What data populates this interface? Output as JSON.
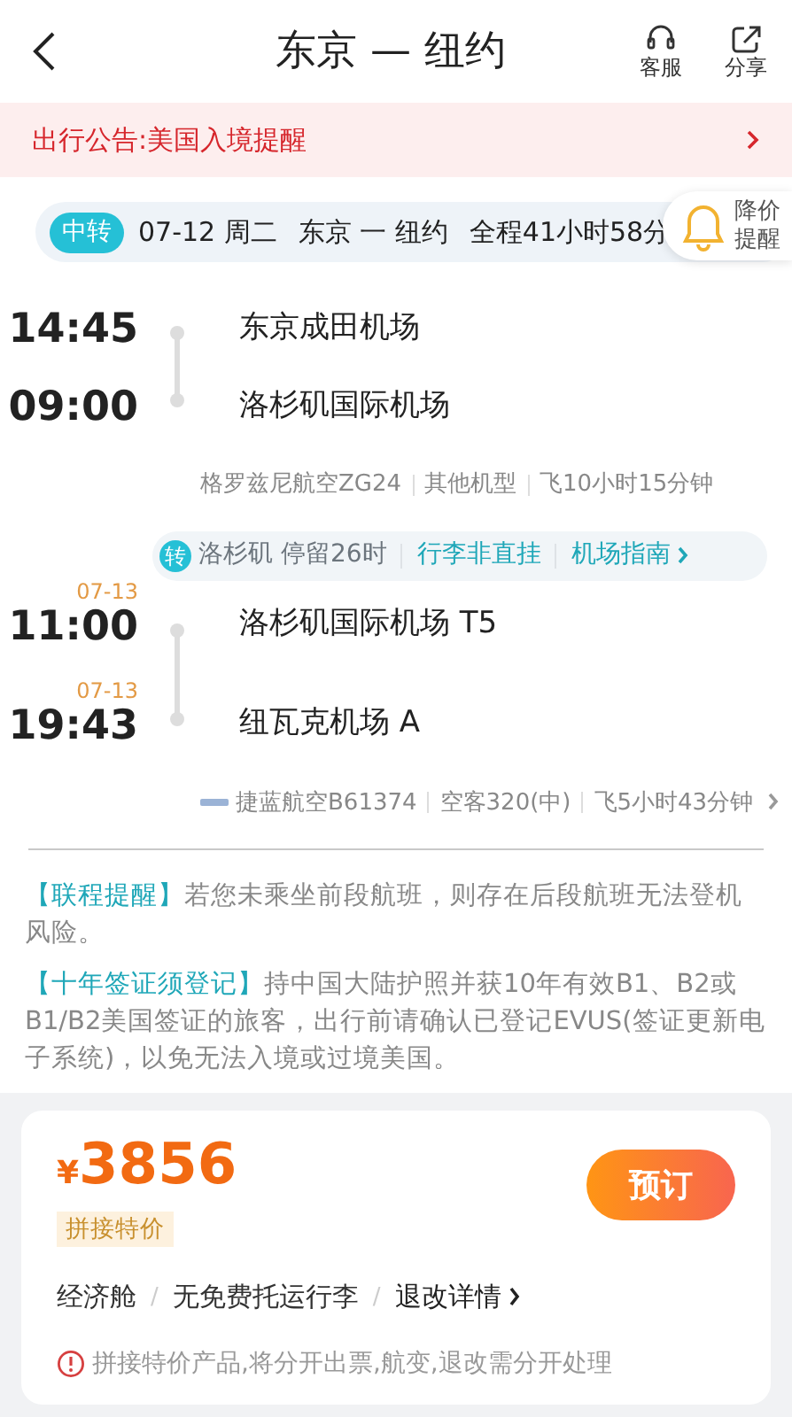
{
  "header": {
    "title": "东京 — 纽约",
    "actions": [
      {
        "kind": "service",
        "label": "客服"
      },
      {
        "kind": "share",
        "label": "分享"
      }
    ]
  },
  "notice": {
    "text": "出行公告:美国入境提醒"
  },
  "summary": {
    "badge": "中转",
    "date": "07-12 周二",
    "route": "东京 一 纽约",
    "duration": "全程41小时58分"
  },
  "price_alert": {
    "label": "降价提醒"
  },
  "segments": [
    {
      "departure": {
        "time": "14:45",
        "airport": "东京成田机场"
      },
      "arrival": {
        "time": "09:00",
        "airport": "洛杉矶国际机场"
      },
      "airline_logo": false,
      "details": [
        "格罗兹尼航空ZG24",
        "其他机型",
        "飞10小时15分钟"
      ],
      "expandable": false
    },
    {
      "departure": {
        "date": "07-13",
        "time": "11:00",
        "airport": "洛杉矶国际机场 T5"
      },
      "arrival": {
        "date": "07-13",
        "time": "19:43",
        "airport": "纽瓦克机场 A"
      },
      "airline_logo": true,
      "details": [
        "捷蓝航空B61374",
        "空客320(中)",
        "飞5小时43分钟"
      ],
      "expandable": true
    }
  ],
  "transfer": {
    "badge": "转",
    "stay": "洛杉矶 停留26时",
    "baggage": "行李非直挂",
    "guide": "机场指南"
  },
  "notes": [
    {
      "title": "【联程提醒】",
      "text": "若您未乘坐前段航班，则存在后段航班无法登机风险。"
    },
    {
      "title": "【十年签证须登记】",
      "text": "持中国大陆护照并获10年有效B1、B2或B1/B2美国签证的旅客，出行前请确认已登记EVUS(签证更新电子系统)，以免无法入境或过境美国。"
    }
  ],
  "fare": {
    "currency": "¥",
    "price": "3856",
    "tag": "拼接特价",
    "button": "预订",
    "options": [
      {
        "label": "经济舱",
        "link": false
      },
      {
        "label": "无免费托运行李",
        "link": false
      },
      {
        "label": "退改详情",
        "link": true
      }
    ],
    "separator": "/",
    "warning": "拼接特价产品,将分开出票,航变,退改需分开处理"
  }
}
